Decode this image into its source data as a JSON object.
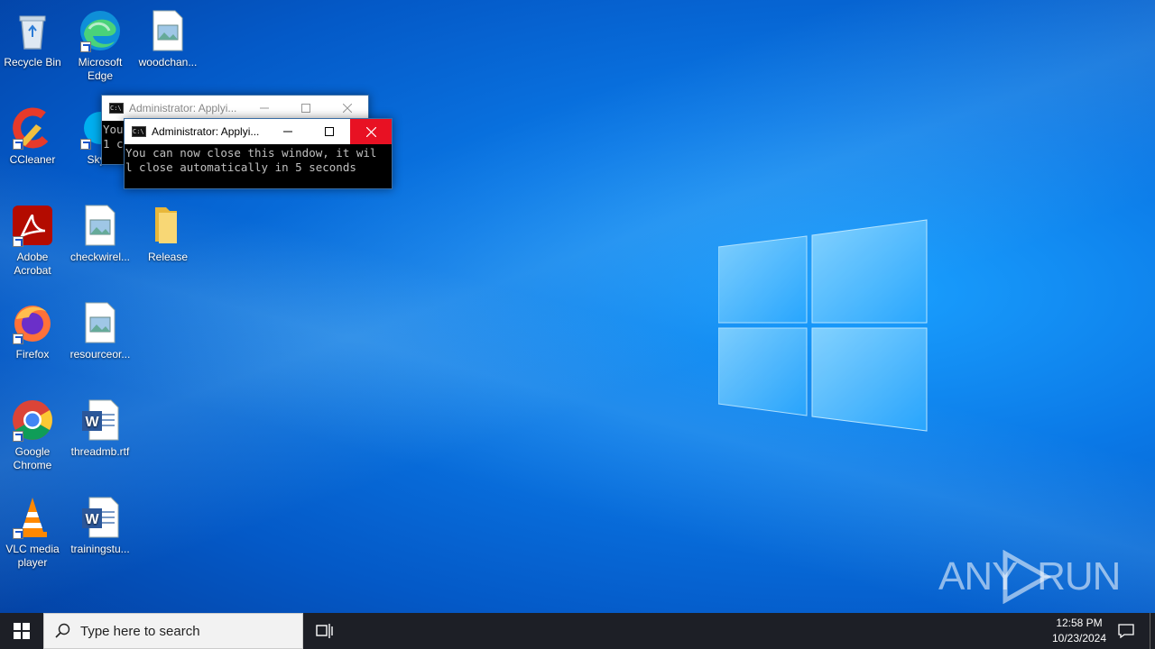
{
  "desktop": {
    "icons": [
      {
        "label": "Recycle Bin"
      },
      {
        "label": "Microsoft Edge"
      },
      {
        "label": "woodchan..."
      },
      {
        "label": "CCleaner"
      },
      {
        "label": "Sky..."
      },
      {
        "label": "Adobe Acrobat"
      },
      {
        "label": "checkwirel..."
      },
      {
        "label": "Release"
      },
      {
        "label": "Firefox"
      },
      {
        "label": "resourceor..."
      },
      {
        "label": "Google Chrome"
      },
      {
        "label": "threadmb.rtf"
      },
      {
        "label": "VLC media player"
      },
      {
        "label": "trainingstu..."
      }
    ]
  },
  "windows": {
    "back": {
      "title": "Administrator:  Applyi...",
      "console_text": "You c\n1 c"
    },
    "front": {
      "title": "Administrator:  Applyi...",
      "console_text": "You can now close this window, it wil\nl close automatically in 5 seconds"
    }
  },
  "watermark": {
    "text": "ANY  RUN"
  },
  "taskbar": {
    "search_placeholder": "Type here to search",
    "time": "12:58 PM",
    "date": "10/23/2024"
  },
  "colors": {
    "close_active": "#e81123",
    "taskbar_bg": "#1d1f26",
    "desktop_blue": "#0a78e6"
  }
}
